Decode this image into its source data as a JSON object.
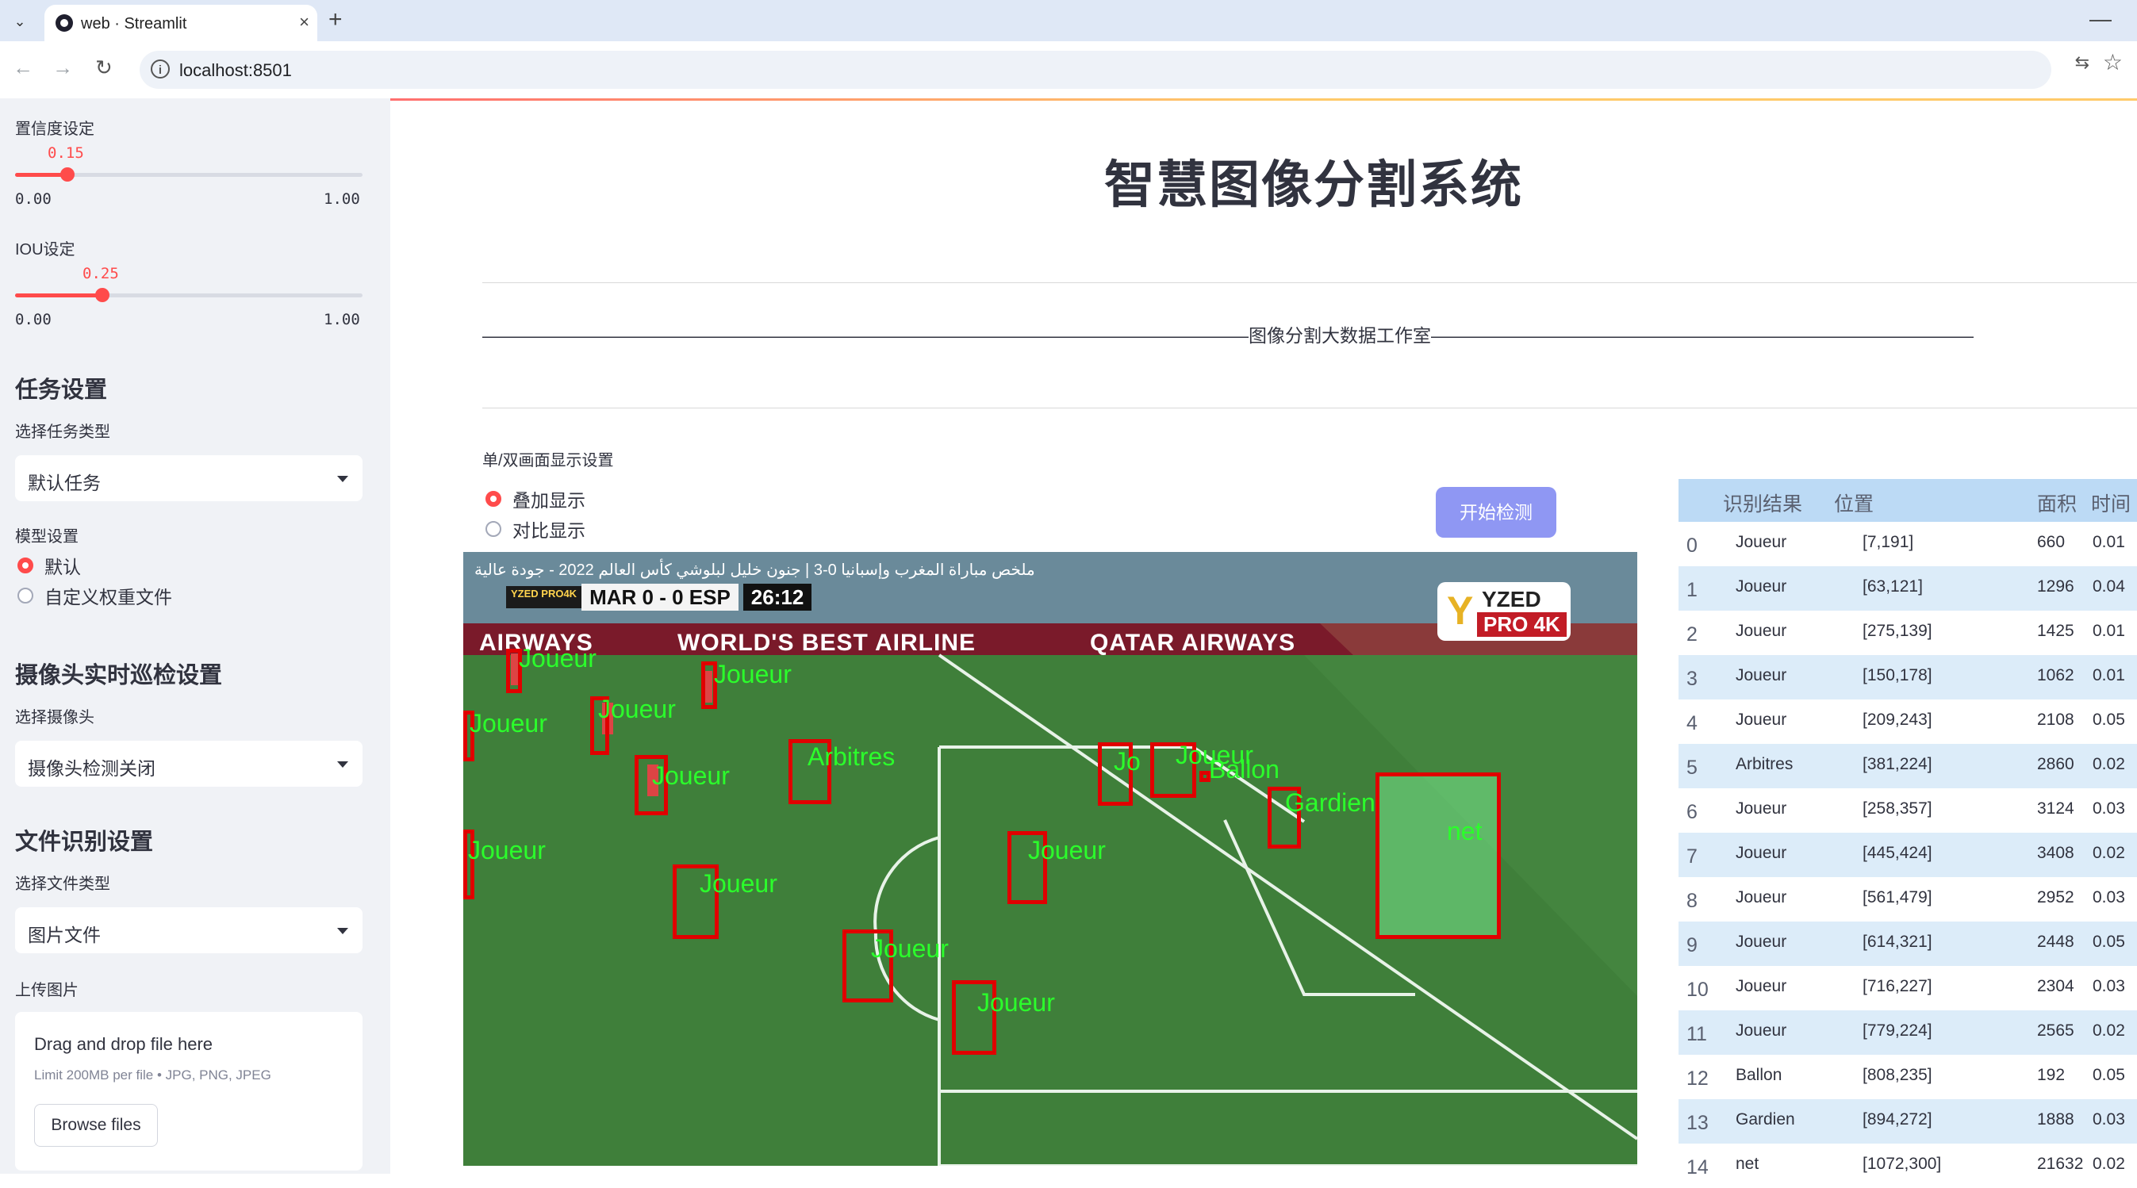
{
  "browser": {
    "tab_title": "web · Streamlit",
    "close_glyph": "×",
    "new_tab_glyph": "+",
    "minimize_glyph": "—",
    "url": "localhost:8501",
    "nav": {
      "back": "←",
      "forward": "→",
      "reload": "↻"
    },
    "info_glyph": "i",
    "translate_glyph": "⇆",
    "star_glyph": "☆",
    "tab_list_glyph": "⌄"
  },
  "sidebar": {
    "confidence": {
      "label": "置信度设定",
      "value": "0.15",
      "fraction": 0.15,
      "min": "0.00",
      "max": "1.00"
    },
    "iou": {
      "label": "IOU设定",
      "value": "0.25",
      "fraction": 0.25,
      "min": "0.00",
      "max": "1.00"
    },
    "task_section": "任务设置",
    "task_type_label": "选择任务类型",
    "task_type_value": "默认任务",
    "model_label": "模型设置",
    "model_options": [
      "默认",
      "自定义权重文件"
    ],
    "camera_section": "摄像头实时巡检设置",
    "camera_label": "选择摄像头",
    "camera_value": "摄像头检测关闭",
    "file_section": "文件识别设置",
    "file_type_label": "选择文件类型",
    "file_type_value": "图片文件",
    "upload_label": "上传图片",
    "upload_title": "Drag and drop file here",
    "upload_limit": "Limit 200MB per file • JPG, PNG, JPEG",
    "browse_label": "Browse files"
  },
  "main": {
    "title": "智慧图像分割系统",
    "studio_banner": "——————————————————————————————————————————图像分割大数据工作室——————————————————————————————————————————",
    "display_label": "单/双画面显示设置",
    "display_options": [
      "叠加显示",
      "对比显示"
    ],
    "start_button": "开始检测"
  },
  "video": {
    "caption": "ملخص مباراة المغرب وإسبانيا 0-3 | جنون خليل لبلوشي كأس العالم 2022 - جودة عالية",
    "score_logo": "YZED PRO4K",
    "score_teams": "MAR 0 - 0 ESP",
    "score_time": "26:12",
    "brand_top": "YZED",
    "brand_bottom": "PRO 4K",
    "brand_mark": "Y",
    "banner_left": "AIRWAYS",
    "banner_mid": "WORLD'S BEST AIRLINE",
    "banner_right": "QATAR AIRWAYS",
    "labels": {
      "l1": "Joueur",
      "l2": "Joueur",
      "l3": "Joueur",
      "l4": "Joueur",
      "l5": "Joueur",
      "l6": "Arbitres",
      "l7": "Jo",
      "l8": "Joueur",
      "l9": "Ballon",
      "l10": "Gardien",
      "l11": "net",
      "l12": "Joueur",
      "l13": "Joueur",
      "l14": "Joueur",
      "l15": "Joueur",
      "l16": "Joueur"
    }
  },
  "table": {
    "headers": [
      "识别结果",
      "位置",
      "面积",
      "时间"
    ],
    "rows": [
      {
        "idx": "0",
        "label": "Joueur",
        "pos": "[7,191]",
        "area": "660",
        "time": "0.01"
      },
      {
        "idx": "1",
        "label": "Joueur",
        "pos": "[63,121]",
        "area": "1296",
        "time": "0.04"
      },
      {
        "idx": "2",
        "label": "Joueur",
        "pos": "[275,139]",
        "area": "1425",
        "time": "0.01"
      },
      {
        "idx": "3",
        "label": "Joueur",
        "pos": "[150,178]",
        "area": "1062",
        "time": "0.01"
      },
      {
        "idx": "4",
        "label": "Joueur",
        "pos": "[209,243]",
        "area": "2108",
        "time": "0.05"
      },
      {
        "idx": "5",
        "label": "Arbitres",
        "pos": "[381,224]",
        "area": "2860",
        "time": "0.02"
      },
      {
        "idx": "6",
        "label": "Joueur",
        "pos": "[258,357]",
        "area": "3124",
        "time": "0.03"
      },
      {
        "idx": "7",
        "label": "Joueur",
        "pos": "[445,424]",
        "area": "3408",
        "time": "0.02"
      },
      {
        "idx": "8",
        "label": "Joueur",
        "pos": "[561,479]",
        "area": "2952",
        "time": "0.03"
      },
      {
        "idx": "9",
        "label": "Joueur",
        "pos": "[614,321]",
        "area": "2448",
        "time": "0.05"
      },
      {
        "idx": "10",
        "label": "Joueur",
        "pos": "[716,227]",
        "area": "2304",
        "time": "0.03"
      },
      {
        "idx": "11",
        "label": "Joueur",
        "pos": "[779,224]",
        "area": "2565",
        "time": "0.02"
      },
      {
        "idx": "12",
        "label": "Ballon",
        "pos": "[808,235]",
        "area": "192",
        "time": "0.05"
      },
      {
        "idx": "13",
        "label": "Gardien",
        "pos": "[894,272]",
        "area": "1888",
        "time": "0.03"
      },
      {
        "idx": "14",
        "label": "net",
        "pos": "[1072,300]",
        "area": "21632",
        "time": "0.02"
      }
    ]
  },
  "colors": {
    "accent": "#ff4b4b",
    "button": "#8f97f3",
    "box": "#e00000",
    "box_label": "#2bff2b",
    "table_header": "#bcdaf5"
  }
}
